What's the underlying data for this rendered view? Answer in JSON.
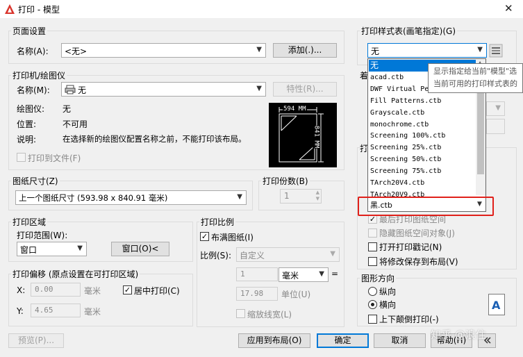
{
  "window": {
    "title": "打印 - 模型"
  },
  "page_setup": {
    "group": "页面设置",
    "name_label": "名称(A):",
    "name_value": "<无>",
    "add_button": "添加(.)..."
  },
  "printer": {
    "group": "打印机/绘图仪",
    "name_label": "名称(M):",
    "name_value": "无",
    "properties_button": "特性(R)...",
    "plotter_label": "绘图仪:",
    "plotter_value": "无",
    "location_label": "位置:",
    "location_value": "不可用",
    "desc_label": "说明:",
    "desc_value": "在选择新的绘图仪配置名称之前，不能打印该布局。",
    "plot_to_file": "打印到文件(F)",
    "preview_width": "594 MM",
    "preview_height": "841 MM"
  },
  "paper_size": {
    "group": "图纸尺寸(Z)",
    "value": "上一个图纸尺寸 (593.98 x 840.91 毫米)"
  },
  "copies": {
    "group": "打印份数(B)",
    "value": "1"
  },
  "plot_area": {
    "group": "打印区域",
    "range_label": "打印范围(W):",
    "range_value": "窗口",
    "window_button": "窗口(O)<"
  },
  "plot_offset": {
    "group": "打印偏移 (原点设置在可打印区域)",
    "x_label": "X:",
    "x_value": "0.00",
    "y_label": "Y:",
    "y_value": "4.65",
    "unit": "毫米",
    "center_label": "居中打印(C)"
  },
  "plot_scale": {
    "group": "打印比例",
    "fit_label": "布满图纸(I)",
    "scale_label": "比例(S):",
    "scale_value": "自定义",
    "value1": "1",
    "unit_value": "毫米",
    "equals": "=",
    "value2": "17.98",
    "unit_label": "单位(U)",
    "lineweights_label": "缩放线宽(L)"
  },
  "plot_style": {
    "group": "打印样式表(画笔指定)(G)",
    "value": "无",
    "options": [
      "无",
      "acad.ctb",
      "DWF Virtual Pens.ctb",
      "Fill Patterns.ctb",
      "Grayscale.ctb",
      "monochrome.ctb",
      "Screening 100%.ctb",
      "Screening 25%.ctb",
      "Screening 50%.ctb",
      "Screening 75%.ctb",
      "TArch20V4.ctb",
      "TArch20V9.ctb",
      "黑.ctb"
    ],
    "tooltip_line1": "显示指定给当前\"模型\"选",
    "tooltip_line2": "当前可用的打印样式表的"
  },
  "behind_dropdown": {
    "label_a": "着",
    "label_b": "打"
  },
  "plot_options": {
    "last_paperspace": "最后打印图纸空间",
    "hide_paperspace": "隐藏图纸空间对象(J)",
    "stamp_on": "打开打印戳记(N)",
    "save_changes": "将修改保存到布局(V)"
  },
  "orientation": {
    "group": "图形方向",
    "portrait": "纵向",
    "landscape": "横向",
    "upside_down": "上下颠倒打印(-)",
    "icon_letter": "A"
  },
  "footer": {
    "preview_button": "预览(P)...",
    "apply_button": "应用到布局(O)",
    "ok_button": "确定",
    "cancel_button": "取消",
    "help_button": "帮助(H)",
    "watermark": "知乎 @浪住"
  },
  "colors": {
    "accent": "#0078d7",
    "highlight": "#e0201a",
    "title_icon": "#d9342b"
  }
}
